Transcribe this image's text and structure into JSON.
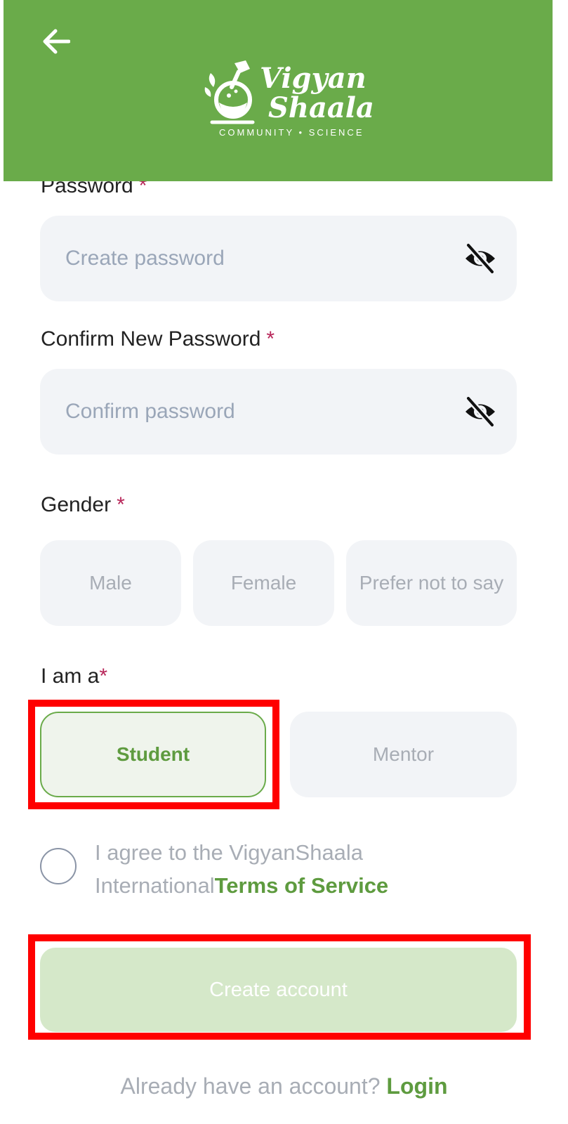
{
  "header": {
    "back_icon": "arrow-left-icon",
    "logo": {
      "line1": "Vigyan",
      "line2": "Shaala",
      "tagline": "COMMUNITY • SCIENCE"
    },
    "background_color": "#6aab4a"
  },
  "form": {
    "password": {
      "label": "Password",
      "required_mark": "*",
      "placeholder": "Create password",
      "value": "",
      "toggle_icon": "eye-slash-icon"
    },
    "confirm_password": {
      "label": "Confirm New Password",
      "required_mark": "*",
      "placeholder": "Confirm password",
      "value": "",
      "toggle_icon": "eye-slash-icon"
    },
    "gender": {
      "label": "Gender",
      "required_mark": "*",
      "options": [
        "Male",
        "Female",
        "Prefer not to say"
      ],
      "selected": null
    },
    "role": {
      "label": "I am a",
      "required_mark": "*",
      "options": [
        "Student",
        "Mentor"
      ],
      "selected": "Student"
    },
    "agreement": {
      "text": "I agree to the VigyanShaala International",
      "link_text": "Terms of Service",
      "checked": false
    },
    "submit_label": "Create account"
  },
  "footer": {
    "text": "Already have an account? ",
    "link_text": "Login"
  },
  "colors": {
    "accent": "#6aab4a",
    "required": "#b8275a",
    "field_bg": "#f2f4f7",
    "disabled_button": "#d5e8c9",
    "highlight": "#ff0000"
  }
}
